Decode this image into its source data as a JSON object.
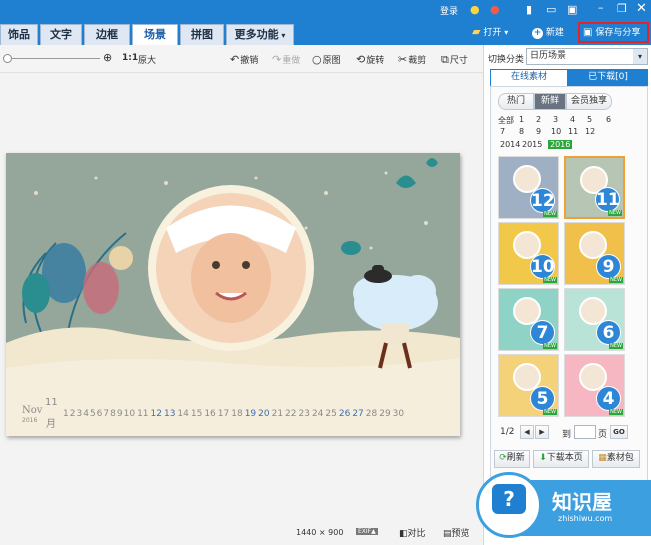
{
  "titlebar": {
    "login": "登录"
  },
  "tabs": [
    "饰品",
    "文字",
    "边框",
    "场景",
    "拼图",
    "更多功能"
  ],
  "header_actions": {
    "open": "打开",
    "new": "新建",
    "save_share": "保存与分享"
  },
  "toolbar": {
    "zoom_ratio": "1:1",
    "original_size": "原大",
    "undo": "撤销",
    "redo": "重做",
    "original": "原图",
    "rotate": "旋转",
    "crop": "裁剪",
    "size": "尺寸"
  },
  "calendar_card": {
    "month": "Nov",
    "month_number": "11",
    "year": "2016",
    "month_cn": "月",
    "days": [
      "1",
      "2",
      "3",
      "4",
      "5",
      "6",
      "7",
      "8",
      "9",
      "10",
      "11",
      "12",
      "13",
      "14",
      "15",
      "16",
      "17",
      "18",
      "19",
      "20",
      "21",
      "22",
      "23",
      "24",
      "25",
      "26",
      "27",
      "28",
      "29",
      "30"
    ],
    "highlight_days": [
      "12",
      "13",
      "19",
      "20",
      "26",
      "27"
    ]
  },
  "status": {
    "dimensions": "1440 × 900",
    "exif": "EXIF▲",
    "compare": "对比",
    "preview": "预览"
  },
  "panel": {
    "category_label": "切换分类",
    "category_value": "日历场景",
    "tab_online": "在线素材",
    "tab_downloaded": "已下载[0]",
    "filters": [
      "热门",
      "新鲜",
      "会员独享"
    ],
    "pages": [
      "全部",
      "1",
      "2",
      "3",
      "4",
      "5",
      "6",
      "7",
      "8",
      "9",
      "10",
      "11",
      "12",
      "2014",
      "2015",
      "2016"
    ],
    "selected_page": "2016",
    "thumbs": [
      "12",
      "11",
      "10",
      "9",
      "7",
      "6",
      "5",
      "4"
    ],
    "new_badge": "NEW",
    "pagination": {
      "current": "1/2",
      "goto": "到",
      "page": "页",
      "go": "GO"
    },
    "actions": {
      "refresh": "刷新",
      "download_page": "下载本页",
      "library": "素材包"
    }
  },
  "watermark": {
    "title": "知识屋",
    "url": "zhishiwu.com"
  },
  "colors": {
    "accent": "#1f7fd0",
    "save_border": "#e0242a",
    "selected_page": "#2aa63b",
    "thumb_badge": "#2d86d6"
  }
}
